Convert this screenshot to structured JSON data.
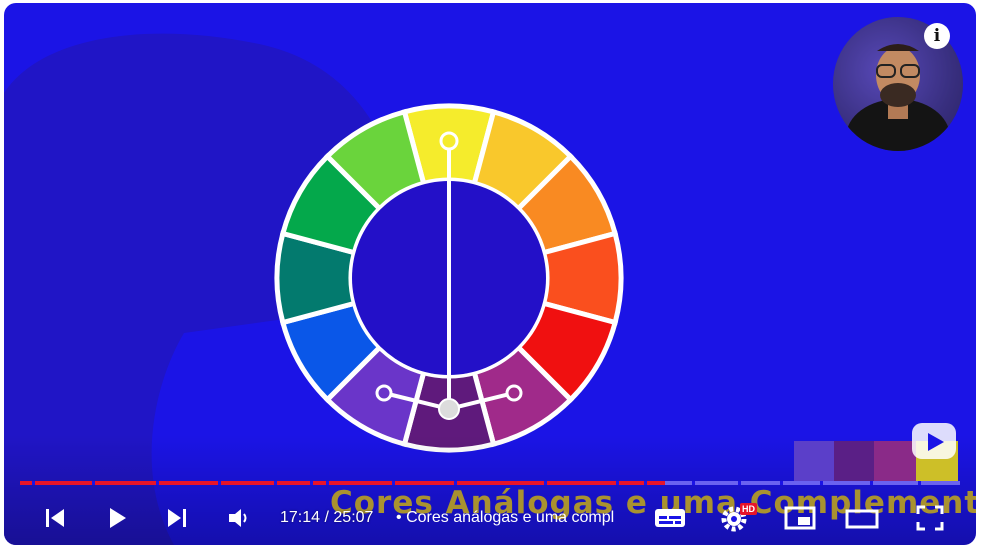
{
  "player": {
    "caption_text": "Cores Análogas e uma Complementar",
    "time_current": "17:14",
    "time_separator": " / ",
    "time_total": "25:07",
    "chapter_bullet": "•",
    "chapter_title": "Cores análogas e uma compl",
    "progress_fraction": 0.686,
    "hd_badge": "HD",
    "info_label": "i"
  },
  "icons": {
    "previous": "skip-previous-icon",
    "play": "play-icon",
    "next": "skip-next-icon",
    "volume": "volume-icon",
    "subtitles": "subtitles-icon",
    "settings": "gear-icon",
    "miniplayer": "miniplayer-icon",
    "theater": "theater-mode-icon",
    "fullscreen": "fullscreen-icon"
  },
  "colors": {
    "background": "#1b14e6",
    "progress_played": "#e8142a",
    "progress_remaining": "#6a62f0",
    "caption": "#b9a020",
    "wheel": [
      "#f5ec2c",
      "#f9c82c",
      "#f98a22",
      "#fa4f1e",
      "#f01010",
      "#a02a8a",
      "#5f1a7c",
      "#6a35c9",
      "#0a57e8",
      "#037a6e",
      "#04a84b",
      "#6ad43c"
    ]
  }
}
